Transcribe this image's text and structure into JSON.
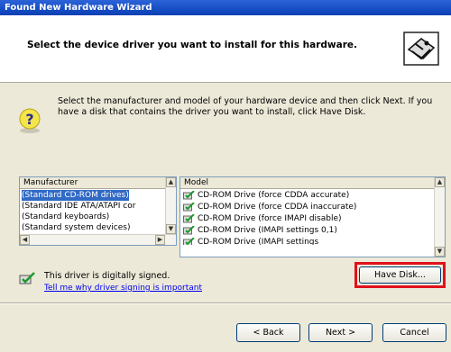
{
  "window": {
    "title": "Found New Hardware Wizard"
  },
  "header": {
    "title": "Select the device driver you want to install for this hardware.",
    "icon": "hardware-wizard-icon"
  },
  "instructions": "Select the manufacturer and model of your hardware device and then click Next. If you have a disk that contains the driver you want to install, click Have Disk.",
  "manufacturer": {
    "header": "Manufacturer",
    "items": [
      "(Standard CD-ROM drives)",
      "(Standard IDE ATA/ATAPI cor",
      "(Standard keyboards)",
      "(Standard system devices)"
    ],
    "selected_index": 0
  },
  "model": {
    "header": "Model",
    "items": [
      "CD-ROM Drive (force CDDA accurate)",
      "CD-ROM Drive (force CDDA inaccurate)",
      "CD-ROM Drive (force IMAPI disable)",
      "CD-ROM Drive (IMAPI settings 0,1)",
      "CD-ROM Drive (IMAPI settings"
    ],
    "item_icon": "driver-icon"
  },
  "signature": {
    "text": "This driver is digitally signed.",
    "link": "Tell me why driver signing is important",
    "icon": "signed-driver-icon"
  },
  "buttons": {
    "have_disk": "Have Disk...",
    "back": "< Back",
    "next": "Next >",
    "cancel": "Cancel"
  },
  "colors": {
    "title_bar": "#0a3fb4",
    "selection": "#316ac5",
    "highlight_box": "#e0111b",
    "link": "#0000ee"
  }
}
